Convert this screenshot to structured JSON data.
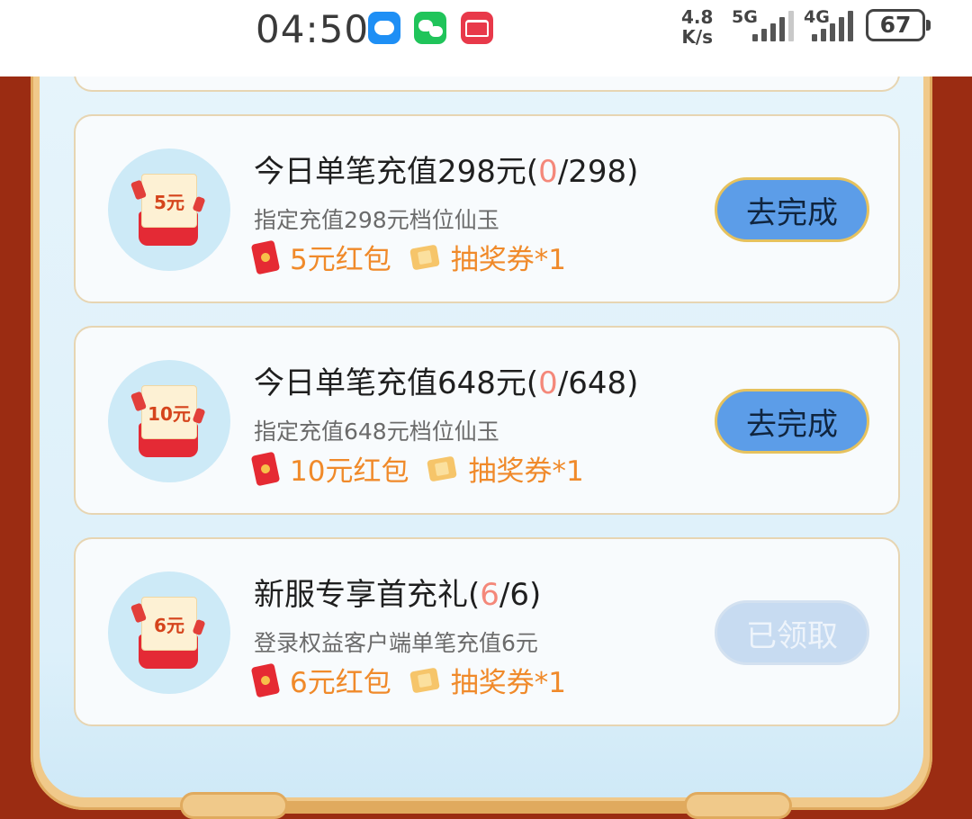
{
  "status_bar": {
    "time": "04:50",
    "apps": [
      "message-icon",
      "wechat-icon",
      "huawei-icon"
    ],
    "net_speed_value": "4.8",
    "net_speed_unit": "K/s",
    "net1": "5G",
    "net2": "4G",
    "battery": "67"
  },
  "tasks": [
    {
      "envelope_label": "5元",
      "title_prefix": "今日单笔充值298元(",
      "progress_current": "0",
      "progress_suffix": "/298)",
      "description": "指定充值298元档位仙玉",
      "reward_redpack": "5元红包",
      "reward_ticket": "抽奖券*1",
      "button_label": "去完成",
      "button_state": "go"
    },
    {
      "envelope_label": "10元",
      "title_prefix": "今日单笔充值648元(",
      "progress_current": "0",
      "progress_suffix": "/648)",
      "description": "指定充值648元档位仙玉",
      "reward_redpack": "10元红包",
      "reward_ticket": "抽奖券*1",
      "button_label": "去完成",
      "button_state": "go"
    },
    {
      "envelope_label": "6元",
      "title_prefix": "新服专享首充礼(",
      "progress_current": "6",
      "progress_suffix": "/6)",
      "description": "登录权益客户端单笔充值6元",
      "reward_redpack": "6元红包",
      "reward_ticket": "抽奖券*1",
      "button_label": "已领取",
      "button_state": "done"
    }
  ],
  "colors": {
    "background": "#9b2c12",
    "panel": "#e6f4fb",
    "progress_highlight": "#f4887a",
    "reward_text": "#f08a2a",
    "button_active": "#5c9de8",
    "button_disabled": "#c7dbf1"
  }
}
